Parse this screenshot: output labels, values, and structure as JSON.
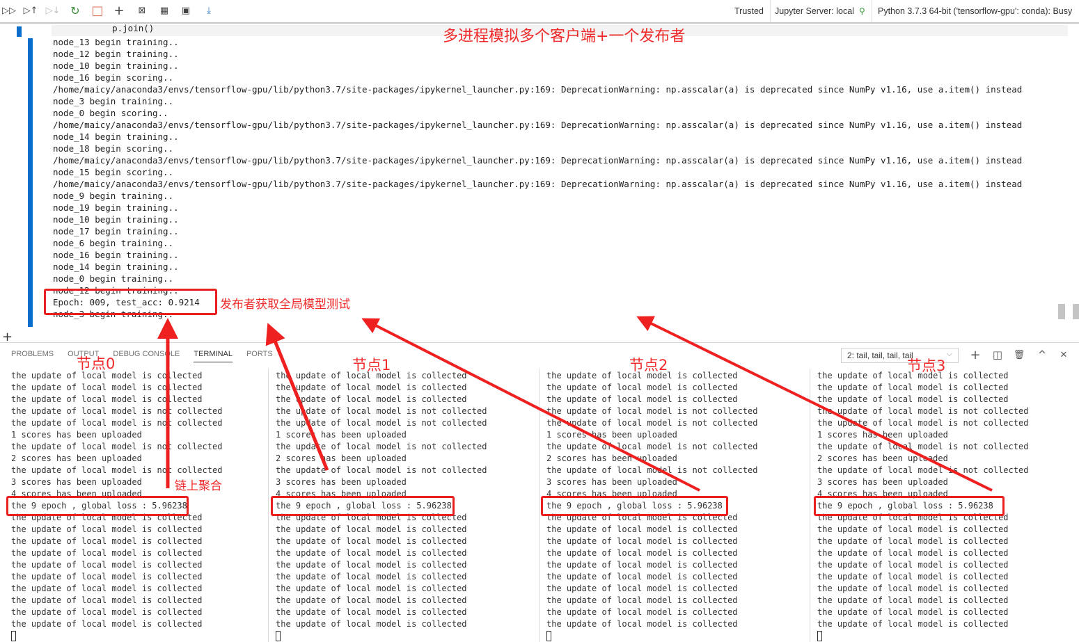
{
  "toolbar": {
    "icons": [
      {
        "name": "run-all-icon",
        "glyph": "▷▷"
      },
      {
        "name": "run-above-icon",
        "glyph": "▷↑"
      },
      {
        "name": "run-below-icon",
        "glyph": "▷↓"
      },
      {
        "name": "restart-kernel-icon",
        "glyph": "↻"
      },
      {
        "name": "interrupt-kernel-icon",
        "glyph": "□"
      },
      {
        "name": "add-cell-icon",
        "glyph": "+"
      },
      {
        "name": "clear-outputs-icon",
        "glyph": "⊠"
      },
      {
        "name": "variables-icon",
        "glyph": "▦"
      },
      {
        "name": "save-icon",
        "glyph": "▣"
      },
      {
        "name": "export-icon",
        "glyph": "⤓"
      }
    ],
    "trusted": "Trusted",
    "server": "Jupyter Server: local",
    "kernel": "Python 3.7.3 64-bit ('tensorflow-gpu': conda): Busy"
  },
  "notebook": {
    "code_line": "    p.join()",
    "output_lines": [
      "node_13 begin training..",
      "node_12 begin training..",
      "node_10 begin training..",
      "node_16 begin scoring..",
      "/home/maicy/anaconda3/envs/tensorflow-gpu/lib/python3.7/site-packages/ipykernel_launcher.py:169: DeprecationWarning: np.asscalar(a) is deprecated since NumPy v1.16, use a.item() instead",
      "node_3 begin training..",
      "node_0 begin scoring..",
      "/home/maicy/anaconda3/envs/tensorflow-gpu/lib/python3.7/site-packages/ipykernel_launcher.py:169: DeprecationWarning: np.asscalar(a) is deprecated since NumPy v1.16, use a.item() instead",
      "node_14 begin training..",
      "node_18 begin scoring..",
      "/home/maicy/anaconda3/envs/tensorflow-gpu/lib/python3.7/site-packages/ipykernel_launcher.py:169: DeprecationWarning: np.asscalar(a) is deprecated since NumPy v1.16, use a.item() instead",
      "node_15 begin scoring..",
      "/home/maicy/anaconda3/envs/tensorflow-gpu/lib/python3.7/site-packages/ipykernel_launcher.py:169: DeprecationWarning: np.asscalar(a) is deprecated since NumPy v1.16, use a.item() instead",
      "node_9 begin training..",
      "node_19 begin training..",
      "node_10 begin training..",
      "node_17 begin training..",
      "node_6 begin training..",
      "node_16 begin training..",
      "node_14 begin training..",
      "node_0 begin training..",
      "node_12 begin training..",
      "Epoch: 009, test_acc: 0.9214",
      "node_3 begin training.."
    ]
  },
  "panel": {
    "tabs": [
      "PROBLEMS",
      "OUTPUT",
      "DEBUG CONSOLE",
      "TERMINAL",
      "PORTS"
    ],
    "active_tab": "TERMINAL",
    "terminal_select": "2: tail, tail, tail, tail",
    "icons": [
      {
        "name": "new-terminal-icon",
        "glyph": "+"
      },
      {
        "name": "split-terminal-icon",
        "glyph": "◫"
      },
      {
        "name": "kill-terminal-icon",
        "glyph": "🗑"
      },
      {
        "name": "maximize-panel-icon",
        "glyph": "^"
      },
      {
        "name": "close-panel-icon",
        "glyph": "✕"
      }
    ],
    "terminal_lines": [
      "the update of local model is collected",
      "the update of local model is collected",
      "the update of local model is collected",
      "the update of local model is not collected",
      "the update of local model is not collected",
      "1 scores has been uploaded",
      "the update of local model is not collected",
      "2 scores has been uploaded",
      "the update of local model is not collected",
      "3 scores has been uploaded",
      "4 scores has been uploaded",
      "the 9 epoch , global loss : 5.96238",
      "the update of local model is collected",
      "the update of local model is collected",
      "the update of local model is collected",
      "the update of local model is collected",
      "the update of local model is collected",
      "the update of local model is collected",
      "the update of local model is collected",
      "the update of local model is collected",
      "the update of local model is collected",
      "the update of local model is collected"
    ]
  },
  "annotations": {
    "title": "多进程模拟多个客户端+一个发布者",
    "publisher": "发布者获取全局模型测试",
    "aggregation": "链上聚合",
    "nodes": [
      "节点0",
      "节点1",
      "节点2",
      "节点3"
    ],
    "color": "#ef2b2b"
  }
}
